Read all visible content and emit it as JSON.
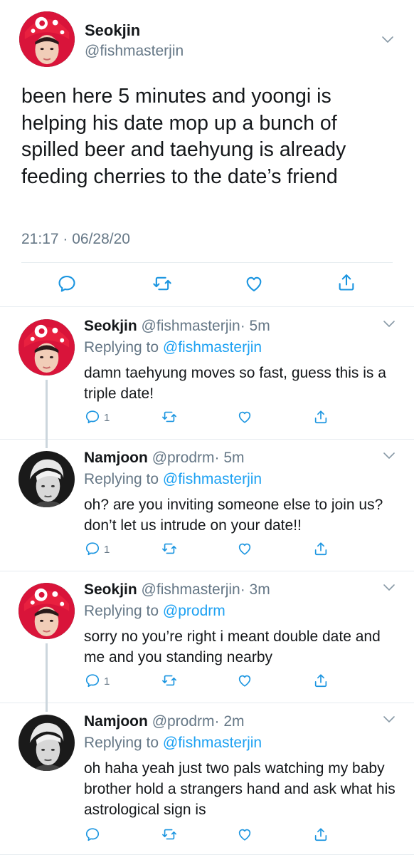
{
  "main_tweet": {
    "display_name": "Seokjin",
    "handle": "@fishmasterjin",
    "text": "been here 5 minutes and yoongi is helping his date mop up a bunch of spilled beer and taehyung is already feeding cherries to the date’s friend",
    "meta": "21:17 · 06/28/20",
    "avatar_icon": "avatar-red-hat",
    "actions": [
      "reply-icon",
      "retweet-icon",
      "like-icon",
      "share-icon"
    ]
  },
  "replies": [
    {
      "display_name": "Seokjin",
      "handle": "@fishmasterjin",
      "time": "· 5m",
      "replying_prefix": "Replying to",
      "replying_to": "@fishmasterjin",
      "text": "damn taehyung moves so fast, guess this is a triple date!",
      "reply_count": "1",
      "avatar_icon": "avatar-red-hat"
    },
    {
      "display_name": "Namjoon",
      "handle": "@prodrm",
      "time": "· 5m",
      "replying_prefix": "Replying to",
      "replying_to": "@fishmasterjin",
      "text": "oh? are you inviting someone else to join us? don’t let us intrude on your date!!",
      "reply_count": "1",
      "avatar_icon": "avatar-grayscale"
    },
    {
      "display_name": "Seokjin",
      "handle": "@fishmasterjin",
      "time": "· 3m",
      "replying_prefix": "Replying to",
      "replying_to": "@prodrm",
      "text": "sorry no you’re right i meant double date and me and you standing nearby",
      "reply_count": "1",
      "avatar_icon": "avatar-red-hat"
    },
    {
      "display_name": "Namjoon",
      "handle": "@prodrm",
      "time": "· 2m",
      "replying_prefix": "Replying to",
      "replying_to": "@fishmasterjin",
      "text": "oh haha yeah just two pals watching my baby brother hold a strangers hand and ask what his astrological sign is",
      "reply_count": "",
      "avatar_icon": "avatar-grayscale"
    }
  ],
  "colors": {
    "link": "#1da1f2",
    "secondary_text": "#657786",
    "icon": "#1b95e0",
    "thread_line": "#ccd6dd"
  }
}
